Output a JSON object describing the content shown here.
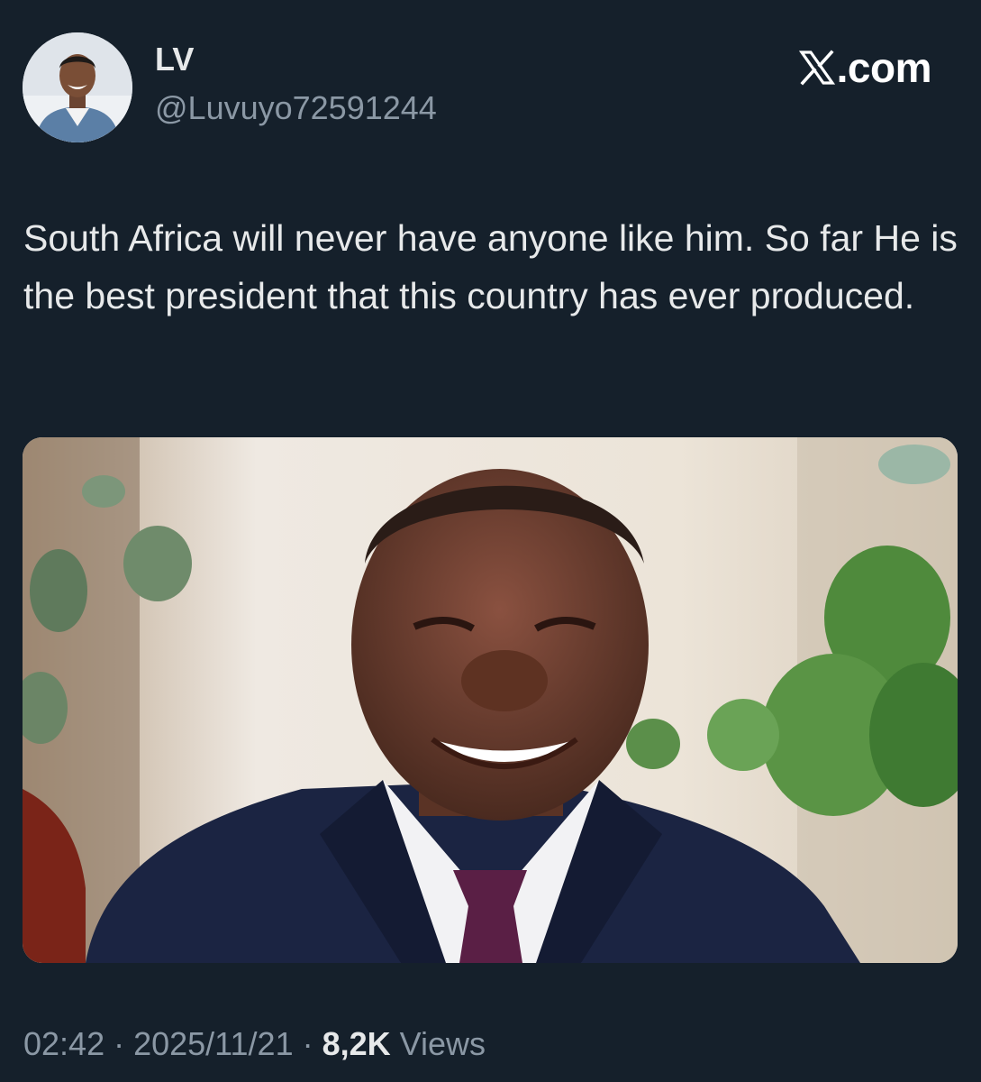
{
  "tweet": {
    "display_name": "LV",
    "handle": "@Luvuyo72591244",
    "site_brand": ".com",
    "text": "South Africa will never have anyone like him. So far He is the best president that this country has ever produced.",
    "media_description_icon": "photo",
    "time": "02:42",
    "separator": " · ",
    "date": "2025/11/21",
    "views_count": "8,2K",
    "views_label": " Views"
  },
  "colors": {
    "background": "#15202b",
    "primary_text": "#e7e9ea",
    "secondary_text": "#8b98a5"
  }
}
